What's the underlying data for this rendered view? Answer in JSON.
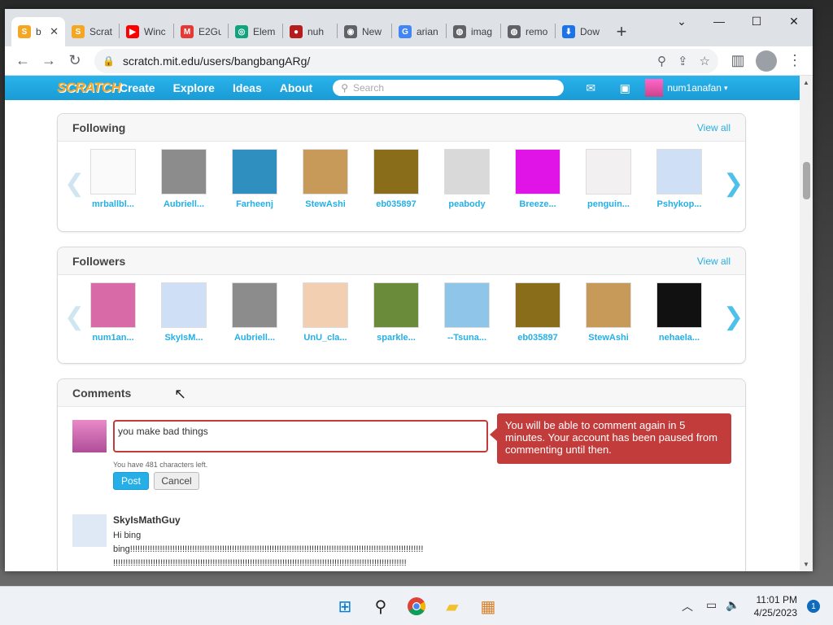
{
  "tabs": [
    {
      "title": "b",
      "color": "#f5a623",
      "glyph": "S",
      "active": true
    },
    {
      "title": "Scrat",
      "color": "#f5a623",
      "glyph": "S"
    },
    {
      "title": "Winc",
      "color": "#ff0000",
      "glyph": "▶"
    },
    {
      "title": "E2Gu",
      "color": "#e53935",
      "glyph": "M"
    },
    {
      "title": "Elem",
      "color": "#10a37f",
      "glyph": "◎"
    },
    {
      "title": "nuh",
      "color": "#b71c1c",
      "glyph": "●"
    },
    {
      "title": "New",
      "color": "#5f6368",
      "glyph": "◉"
    },
    {
      "title": "arian",
      "color": "#4285f4",
      "glyph": "G"
    },
    {
      "title": "imag",
      "color": "#5f6368",
      "glyph": "◍"
    },
    {
      "title": "remo",
      "color": "#5f6368",
      "glyph": "◍"
    },
    {
      "title": "Dow",
      "color": "#1a73e8",
      "glyph": "⬇"
    }
  ],
  "url": "scratch.mit.edu/users/bangbangARg/",
  "nav": {
    "logo": "SCRATCH",
    "links": [
      "Create",
      "Explore",
      "Ideas",
      "About"
    ],
    "search_placeholder": "Search",
    "username": "num1anafan"
  },
  "following": {
    "title": "Following",
    "view_all": "View all",
    "users": [
      {
        "name": "mrballbl...",
        "color": "#fafafa"
      },
      {
        "name": "Aubriell...",
        "color": "#8c8c8c"
      },
      {
        "name": "Farheenj",
        "color": "#2f8fbf"
      },
      {
        "name": "StewAshi",
        "color": "#c79a5a"
      },
      {
        "name": "eb035897",
        "color": "#8a6d1b"
      },
      {
        "name": "peabody",
        "color": "#d9d9d9"
      },
      {
        "name": "Breeze...",
        "color": "#e014e6"
      },
      {
        "name": "penguin...",
        "color": "#f2f0f0"
      },
      {
        "name": "Pshykop...",
        "color": "#cfdff5"
      }
    ]
  },
  "followers": {
    "title": "Followers",
    "view_all": "View all",
    "users": [
      {
        "name": "num1an...",
        "color": "#d96aa8"
      },
      {
        "name": "SkyIsM...",
        "color": "#cfdff5"
      },
      {
        "name": "Aubriell...",
        "color": "#8c8c8c"
      },
      {
        "name": "UnU_cla...",
        "color": "#f2cfb0"
      },
      {
        "name": "sparkle...",
        "color": "#6a8c3a"
      },
      {
        "name": "--Tsuna...",
        "color": "#8ec5e8"
      },
      {
        "name": "eb035897",
        "color": "#8a6d1b"
      },
      {
        "name": "StewAshi",
        "color": "#c79a5a"
      },
      {
        "name": "nehaela...",
        "color": "#111111"
      }
    ]
  },
  "comments": {
    "title": "Comments",
    "draft": "you make bad things",
    "chars_left": "You have 481 characters left.",
    "post_label": "Post",
    "cancel_label": "Cancel",
    "mute_message": "You will be able to comment again in 5 minutes. Your account has been paused from commenting until then.",
    "items": [
      {
        "author": "SkyIsMathGuy",
        "line1": "Hi bing",
        "line2": "bing!!!!!!!!!!!!!!!!!!!!!!!!!!!!!!!!!!!!!!!!!!!!!!!!!!!!!!!!!!!!!!!!!!!!!!!!!!!!!!!!!!!!!!!!!!!!!!!!!!!!!!!!!!!!!!!!!!!!!!",
        "line3": "!!!!!!!!!!!!!!!!!!!!!!!!!!!!!!!!!!!!!!!!!!!!!!!!!!!!!!!!!!!!!!!!!!!!!!!!!!!!!!!!!!!!!!!!!!!!!!!!!!!!!!!!!!!!!!!!!!!!!!"
      }
    ]
  },
  "taskbar": {
    "time": "11:01 PM",
    "date": "4/25/2023",
    "notifications": "1"
  }
}
